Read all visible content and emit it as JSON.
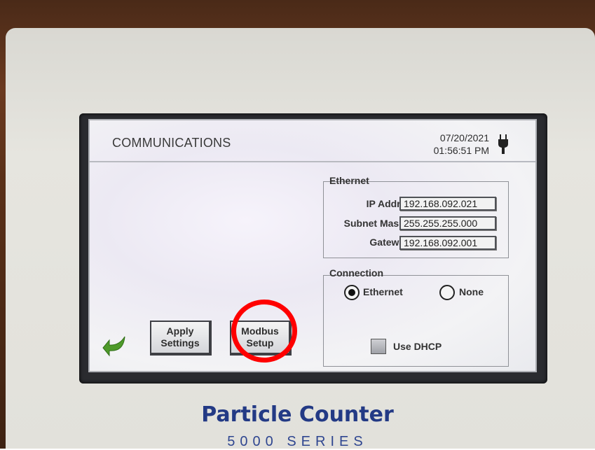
{
  "screen": {
    "title": "COMMUNICATIONS",
    "date": "07/20/2021",
    "time": "01:56:51 PM"
  },
  "ethernet": {
    "legend": "Ethernet",
    "ip_label": "IP Address",
    "ip_value": "192.168.092.021",
    "subnet_label": "Subnet Mask",
    "subnet_value": "255.255.255.000",
    "gateway_label": "Gateway",
    "gateway_value": "192.168.092.001"
  },
  "connection": {
    "legend": "Connection",
    "options": [
      {
        "label": "Ethernet",
        "selected": true
      },
      {
        "label": "None",
        "selected": false
      }
    ],
    "dhcp_label": "Use DHCP",
    "dhcp_checked": false
  },
  "buttons": {
    "apply_line1": "Apply",
    "apply_line2": "Settings",
    "modbus_line1": "Modbus",
    "modbus_line2": "Setup"
  },
  "device": {
    "brand": "Particle Counter",
    "series": "5000 SERIES"
  },
  "colors": {
    "highlight": "#ff0000",
    "brand": "#233a85",
    "back_arrow": "#4e9a2a"
  },
  "icons": {
    "power": "plug-icon",
    "back": "back-arrow-icon"
  }
}
